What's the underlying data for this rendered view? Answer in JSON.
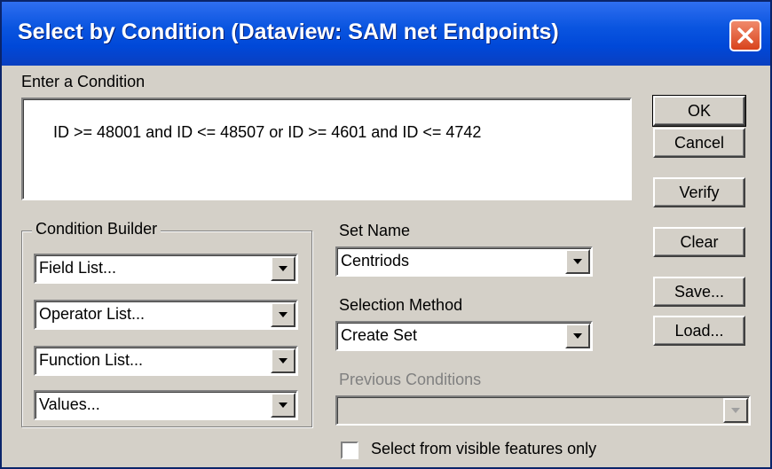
{
  "window": {
    "title": "Select by Condition (Dataview: SAM net Endpoints)",
    "title_bar_color": "#0a55e0",
    "close_icon": "close-icon"
  },
  "condition": {
    "label": "Enter a Condition",
    "value": "ID >= 48001 and ID <= 48507 or ID >= 4601 and ID <= 4742"
  },
  "buttons": {
    "ok": "OK",
    "cancel": "Cancel",
    "verify": "Verify",
    "clear": "Clear",
    "save": "Save...",
    "load": "Load..."
  },
  "condition_builder": {
    "title": "Condition Builder",
    "field_list": "Field List...",
    "operator_list": "Operator List...",
    "function_list": "Function List...",
    "values": "Values..."
  },
  "set_name": {
    "label": "Set Name",
    "value": "Centriods"
  },
  "selection_method": {
    "label": "Selection Method",
    "value": "Create Set"
  },
  "previous_conditions": {
    "label": "Previous Conditions",
    "value": ""
  },
  "visible_only": {
    "label": "Select from visible features only",
    "checked": false
  }
}
